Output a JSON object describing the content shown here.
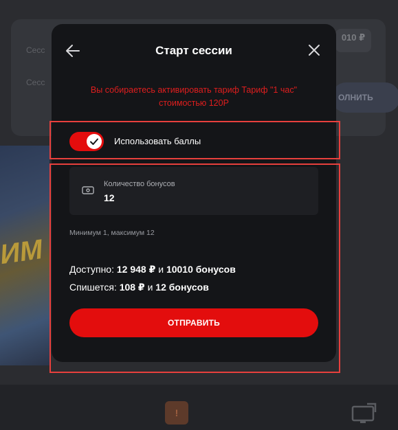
{
  "background": {
    "row1_text": "Сесс",
    "row2_text": "Сесс",
    "balance_chip_value": "010 ₽",
    "balance_chip_sub": "",
    "topup_button_label": "ОЛНИТЬ",
    "banner_text": "ИМ",
    "alert_icon": "!"
  },
  "modal": {
    "title": "Старт сессии",
    "warning": "Вы собираетесь активировать тариф Тариф \"1 час\" стоимостью 120Р",
    "use_points_label": "Использовать баллы",
    "use_points_enabled": true,
    "bonus_field": {
      "label": "Количество бонусов",
      "value": "12"
    },
    "hint": "Минимум 1, максимум 12",
    "available": {
      "prefix": "Доступно: ",
      "money": "12 948 ₽",
      "middle": " и ",
      "bonuses": "10010 бонусов"
    },
    "debit": {
      "prefix": "Спишется: ",
      "money": "108 ₽",
      "middle": " и ",
      "bonuses": "12 бонусов"
    },
    "submit_label": "ОТПРАВИТЬ"
  },
  "icons": {
    "back": "arrow-left-icon",
    "close": "close-icon",
    "check": "check-icon",
    "cash": "cash-icon",
    "monitor": "monitor-icon"
  },
  "colors": {
    "accent": "#e30d0d",
    "warning_text": "#e01e1e",
    "highlight_box": "#e8403d",
    "modal_bg": "#141518"
  }
}
